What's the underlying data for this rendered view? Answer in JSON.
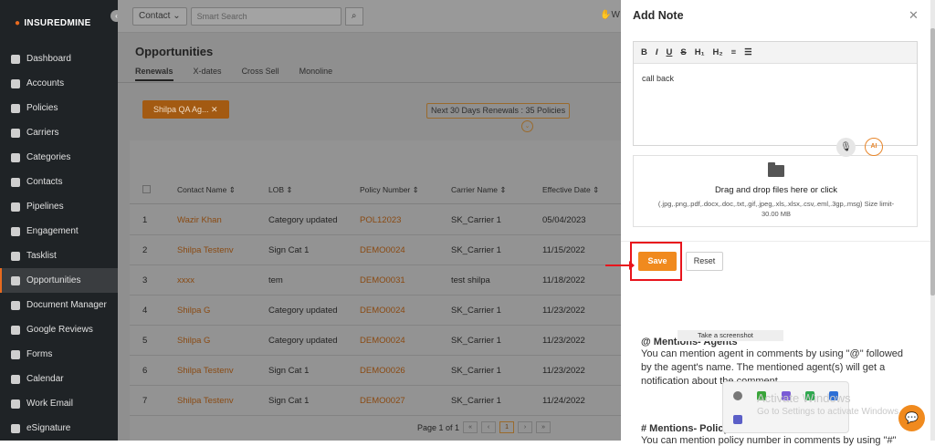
{
  "sidebar": {
    "logo": "INSUREDMINE",
    "items": [
      {
        "label": "Dashboard",
        "icon": "dashboard-icon"
      },
      {
        "label": "Accounts",
        "icon": "accounts-icon"
      },
      {
        "label": "Policies",
        "icon": "policies-icon"
      },
      {
        "label": "Carriers",
        "icon": "carriers-icon"
      },
      {
        "label": "Categories",
        "icon": "categories-icon"
      },
      {
        "label": "Contacts",
        "icon": "contacts-icon"
      },
      {
        "label": "Pipelines",
        "icon": "pipelines-icon"
      },
      {
        "label": "Engagement",
        "icon": "engagement-icon"
      },
      {
        "label": "Tasklist",
        "icon": "tasklist-icon"
      },
      {
        "label": "Opportunities",
        "icon": "opportunities-icon",
        "active": true
      },
      {
        "label": "Document Manager",
        "icon": "folder-icon"
      },
      {
        "label": "Google Reviews",
        "icon": "google-icon"
      },
      {
        "label": "Forms",
        "icon": "forms-icon"
      },
      {
        "label": "Calendar",
        "icon": "calendar-icon"
      },
      {
        "label": "Work Email",
        "icon": "email-icon"
      },
      {
        "label": "eSignature",
        "icon": "signature-icon"
      }
    ]
  },
  "topbar": {
    "contact_select": "Contact",
    "search_placeholder": "Smart Search",
    "user_initial": "W"
  },
  "page": {
    "title": "Opportunities",
    "tabs": [
      "Renewals",
      "X-dates",
      "Cross Sell",
      "Monoline"
    ],
    "filter_chip": "Shilpa QA Ag... ✕",
    "renewals_badge": "Next 30 Days Renewals : 35 Policies"
  },
  "table": {
    "headers": [
      "Contact Name",
      "LOB",
      "Policy Number",
      "Carrier Name",
      "Effective Date"
    ],
    "rows": [
      {
        "n": "1",
        "contact": "Wazir Khan",
        "lob": "Category updated",
        "policy": "POL12023",
        "carrier": "SK_Carrier 1",
        "date": "05/04/2023"
      },
      {
        "n": "2",
        "contact": "Shilpa Testenv",
        "lob": "Sign Cat 1",
        "policy": "DEMO0024",
        "carrier": "SK_Carrier 1",
        "date": "11/15/2022"
      },
      {
        "n": "3",
        "contact": "xxxx",
        "lob": "tem",
        "policy": "DEMO0031",
        "carrier": "test shilpa",
        "date": "11/18/2022"
      },
      {
        "n": "4",
        "contact": "Shilpa G",
        "lob": "Category updated",
        "policy": "DEMO0024",
        "carrier": "SK_Carrier 1",
        "date": "11/23/2022"
      },
      {
        "n": "5",
        "contact": "Shilpa G",
        "lob": "Category updated",
        "policy": "DEMO0024",
        "carrier": "SK_Carrier 1",
        "date": "11/23/2022"
      },
      {
        "n": "6",
        "contact": "Shilpa Testenv",
        "lob": "Sign Cat 1",
        "policy": "DEMO0026",
        "carrier": "SK_Carrier 1",
        "date": "11/23/2022"
      },
      {
        "n": "7",
        "contact": "Shilpa Testenv",
        "lob": "Sign Cat 1",
        "policy": "DEMO0027",
        "carrier": "SK_Carrier 1",
        "date": "11/24/2022"
      }
    ],
    "pager": {
      "label": "Page 1 of 1",
      "current": "1"
    }
  },
  "modal": {
    "title": "Add Note",
    "toolbar": [
      "B",
      "I",
      "U",
      "S",
      "H₁",
      "H₂",
      "≡",
      "☰"
    ],
    "note_text": "call back",
    "ai_label": "AI",
    "drop_title": "Drag and drop files here or click",
    "drop_sub": "(.jpg,.png,.pdf,.docx,.doc,.txt,.gif,.jpeg,.xls,.xlsx,.csv,.eml,.3gp,.msg) Size limit-30.00 MB",
    "save_label": "Save",
    "reset_label": "Reset",
    "mentions_heading": "@ Mentions- Agents",
    "mentions_text": "You can mention agent in comments by using \"@\" followed by the agent's name. The mentioned agent(s) will get a notification about the comment.",
    "mentions2_heading": "# Mentions- Policy",
    "mentions2_text": "You can mention policy number in comments by using \"#\""
  },
  "overlay": {
    "tooltip": "Take a screenshot",
    "watermark_title": "Activate Windows",
    "watermark_sub": "Go to Settings to activate Windows."
  },
  "colors": {
    "accent": "#f08a1e",
    "highlight": "#e8141c",
    "sidebar": "#1f2326"
  }
}
